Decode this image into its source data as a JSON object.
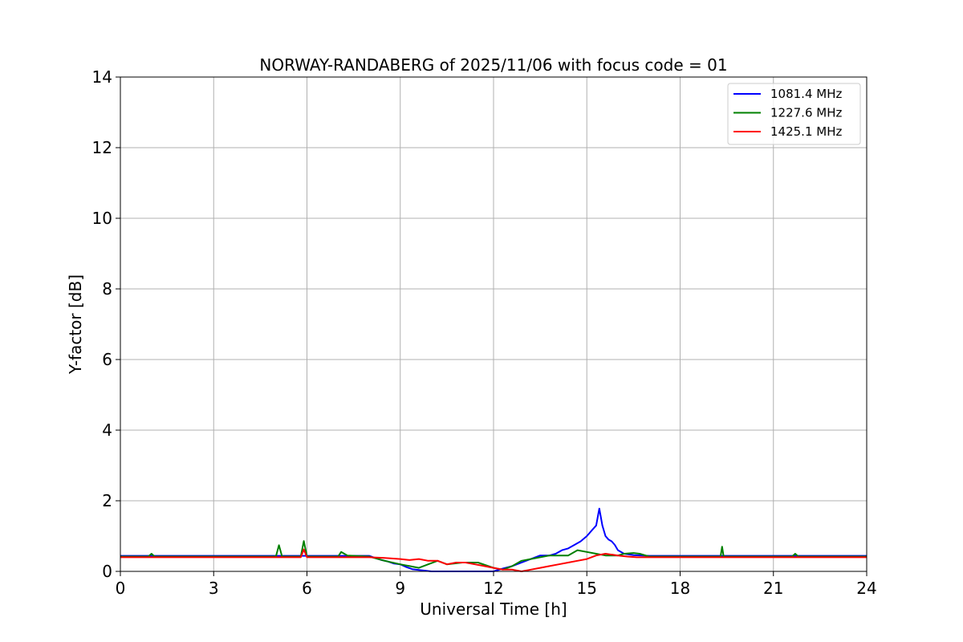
{
  "chart_data": {
    "type": "line",
    "title": "NORWAY-RANDABERG of 2025/11/06 with focus code = 01",
    "xlabel": "Universal Time [h]",
    "ylabel": "Y-factor [dB]",
    "xlim": [
      0,
      24
    ],
    "ylim": [
      0,
      14
    ],
    "xticks": [
      0,
      3,
      6,
      9,
      12,
      15,
      18,
      21,
      24
    ],
    "yticks": [
      0,
      2,
      4,
      6,
      8,
      10,
      12,
      14
    ],
    "grid": true,
    "legend_position": "top-right",
    "series": [
      {
        "name": "1081.4 MHz",
        "color": "#0000ff",
        "x": [
          0,
          1,
          2,
          3,
          4,
          5,
          6,
          7,
          8,
          8.2,
          8.4,
          8.6,
          8.8,
          9.0,
          9.2,
          9.4,
          9.6,
          9.8,
          10.0,
          10.5,
          11.0,
          11.5,
          12.0,
          12.3,
          12.6,
          12.9,
          13.2,
          13.5,
          13.8,
          14.0,
          14.2,
          14.4,
          14.6,
          14.8,
          15.0,
          15.1,
          15.2,
          15.3,
          15.4,
          15.5,
          15.6,
          15.7,
          15.8,
          15.9,
          16.0,
          16.2,
          16.5,
          17,
          18,
          19,
          20,
          21,
          22,
          23,
          24
        ],
        "y": [
          0.44,
          0.44,
          0.44,
          0.44,
          0.44,
          0.44,
          0.44,
          0.44,
          0.44,
          0.38,
          0.32,
          0.28,
          0.22,
          0.2,
          0.12,
          0.06,
          0.04,
          0.02,
          0.0,
          0.0,
          0.0,
          0.0,
          0.0,
          0.08,
          0.15,
          0.25,
          0.35,
          0.45,
          0.45,
          0.5,
          0.6,
          0.65,
          0.75,
          0.85,
          1.0,
          1.1,
          1.2,
          1.3,
          1.78,
          1.3,
          1.0,
          0.9,
          0.85,
          0.75,
          0.6,
          0.5,
          0.46,
          0.44,
          0.44,
          0.44,
          0.44,
          0.44,
          0.44,
          0.44,
          0.44
        ]
      },
      {
        "name": "1227.6 MHz",
        "color": "#008000",
        "x": [
          0,
          0.9,
          1.0,
          1.1,
          2,
          3,
          4,
          5.0,
          5.1,
          5.2,
          5.8,
          5.9,
          6.0,
          7.0,
          7.1,
          7.3,
          8,
          8.5,
          9.0,
          9.3,
          9.6,
          9.9,
          10.2,
          10.5,
          11.0,
          11.5,
          12.0,
          12.3,
          12.6,
          12.9,
          13.2,
          13.5,
          13.8,
          14.1,
          14.4,
          14.7,
          15.0,
          15.3,
          15.6,
          16.0,
          16.2,
          16.5,
          16.7,
          17,
          18,
          19.3,
          19.35,
          19.4,
          20,
          21.6,
          21.7,
          21.8,
          22,
          23,
          24
        ],
        "y": [
          0.42,
          0.42,
          0.5,
          0.42,
          0.42,
          0.42,
          0.42,
          0.42,
          0.74,
          0.42,
          0.42,
          0.86,
          0.42,
          0.42,
          0.55,
          0.45,
          0.42,
          0.3,
          0.2,
          0.15,
          0.1,
          0.2,
          0.3,
          0.2,
          0.25,
          0.25,
          0.1,
          0.05,
          0.15,
          0.3,
          0.35,
          0.4,
          0.45,
          0.45,
          0.45,
          0.6,
          0.55,
          0.5,
          0.45,
          0.45,
          0.5,
          0.52,
          0.5,
          0.42,
          0.42,
          0.42,
          0.7,
          0.42,
          0.42,
          0.42,
          0.5,
          0.42,
          0.42,
          0.42,
          0.42
        ]
      },
      {
        "name": "1425.1 MHz",
        "color": "#ff0000",
        "x": [
          0,
          1,
          2,
          3,
          4,
          5,
          5.8,
          5.9,
          6.0,
          7,
          8,
          8.5,
          9.0,
          9.3,
          9.6,
          9.9,
          10.2,
          10.5,
          10.8,
          11.1,
          11.4,
          11.7,
          12.0,
          12.3,
          12.6,
          12.9,
          13.2,
          13.5,
          13.8,
          14.1,
          14.4,
          14.7,
          15.0,
          15.3,
          15.6,
          16.0,
          16.3,
          16.6,
          17,
          18,
          19,
          20,
          21,
          22,
          23,
          24
        ],
        "y": [
          0.4,
          0.4,
          0.4,
          0.4,
          0.4,
          0.4,
          0.4,
          0.62,
          0.4,
          0.4,
          0.4,
          0.38,
          0.35,
          0.32,
          0.35,
          0.3,
          0.3,
          0.2,
          0.25,
          0.25,
          0.2,
          0.15,
          0.1,
          0.05,
          0.05,
          0.0,
          0.05,
          0.1,
          0.15,
          0.2,
          0.25,
          0.3,
          0.35,
          0.45,
          0.5,
          0.45,
          0.42,
          0.4,
          0.4,
          0.4,
          0.4,
          0.4,
          0.4,
          0.4,
          0.4,
          0.4
        ]
      }
    ]
  }
}
